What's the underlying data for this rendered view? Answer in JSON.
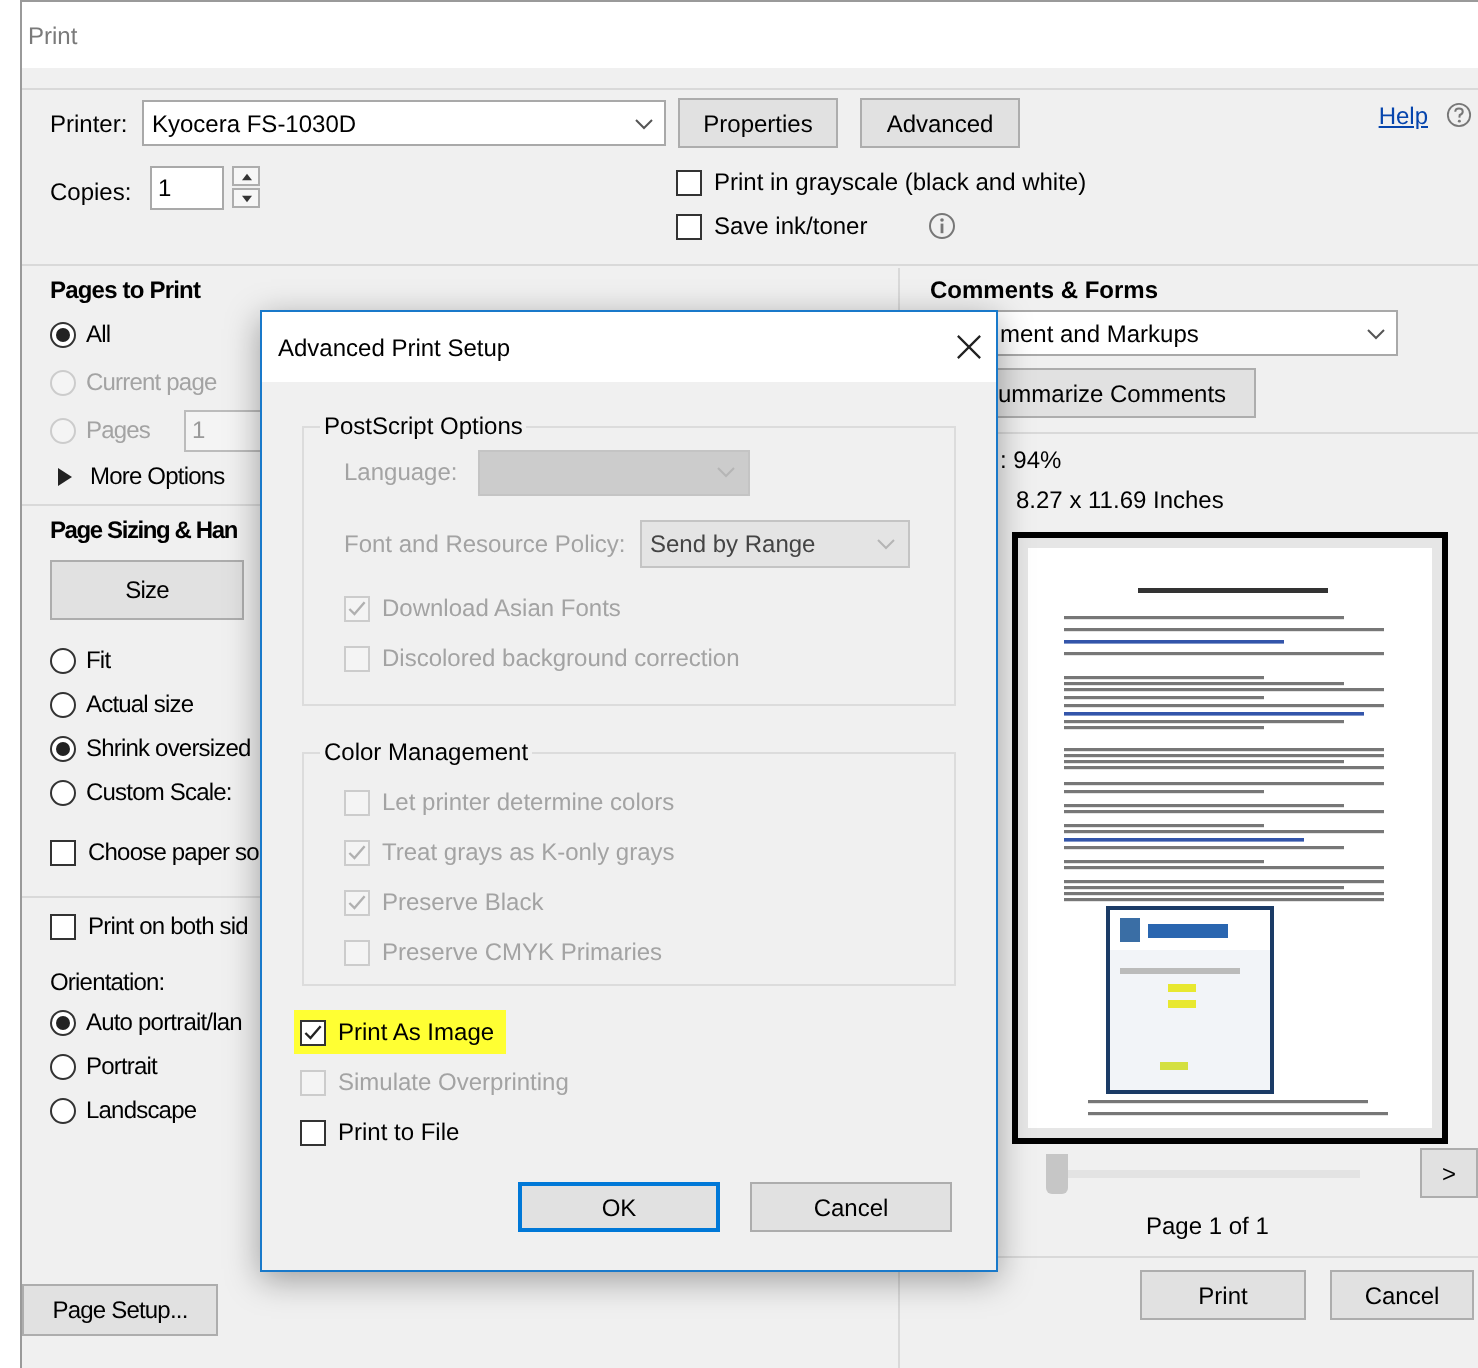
{
  "window": {
    "title": "Print"
  },
  "printer": {
    "label": "Printer:",
    "value": "Kyocera FS-1030D"
  },
  "top_buttons": [
    {
      "label": "Properties"
    },
    {
      "label": "Advanced"
    }
  ],
  "help": {
    "label": "Help"
  },
  "copies": {
    "label": "Copies:",
    "value": "1"
  },
  "print_options": [
    {
      "label": "Print in grayscale (black and white)",
      "checked": false,
      "info": false
    },
    {
      "label": "Save ink/toner",
      "checked": false,
      "info": true
    }
  ],
  "pages_to_print": {
    "title": "Pages to Print",
    "options": [
      {
        "label": "All",
        "selected": true,
        "disabled": false
      },
      {
        "label": "Current page",
        "selected": false,
        "disabled": true
      },
      {
        "label": "Pages",
        "selected": false,
        "disabled": true,
        "value": "1"
      }
    ],
    "more_options": "More Options"
  },
  "page_sizing": {
    "title": "Page Sizing & Han",
    "size_button": "Size",
    "options": [
      {
        "label": "Fit",
        "selected": false
      },
      {
        "label": "Actual size",
        "selected": false
      },
      {
        "label": "Shrink oversized",
        "selected": true
      },
      {
        "label": "Custom Scale:",
        "selected": false
      }
    ],
    "choose_paper": {
      "label": "Choose paper so",
      "checked": false
    }
  },
  "duplex": {
    "label": "Print on both sid",
    "checked": false
  },
  "orientation": {
    "label": "Orientation:",
    "options": [
      {
        "label": "Auto portrait/lan",
        "selected": true
      },
      {
        "label": "Portrait",
        "selected": false
      },
      {
        "label": "Landscape",
        "selected": false
      }
    ]
  },
  "comments_forms": {
    "title": "Comments & Forms",
    "value": "ment and Markups",
    "summarize": "ummarize Comments"
  },
  "preview": {
    "scale": ": 94%",
    "size": "8.27 x 11.69 Inches",
    "slider": {
      "level": 0
    },
    "next": ">",
    "page": "Page 1 of 1"
  },
  "page_setup": "Page Setup...",
  "actions": [
    {
      "label": "Print"
    },
    {
      "label": "Cancel"
    }
  ],
  "advanced_dialog": {
    "title": "Advanced Print Setup",
    "postscript": {
      "title": "PostScript Options",
      "language": {
        "label": "Language:",
        "disabled": true
      },
      "font_policy": {
        "label": "Font and Resource Policy:",
        "value": "Send by Range",
        "disabled": true
      },
      "checks": [
        {
          "label": "Download Asian Fonts",
          "checked": true,
          "disabled": true
        },
        {
          "label": "Discolored background correction",
          "checked": false,
          "disabled": true
        }
      ]
    },
    "color_management": {
      "title": "Color Management",
      "checks": [
        {
          "label": "Let printer determine colors",
          "checked": false,
          "disabled": true
        },
        {
          "label": "Treat grays as K-only grays",
          "checked": true,
          "disabled": true
        },
        {
          "label": "Preserve Black",
          "checked": true,
          "disabled": true
        },
        {
          "label": "Preserve CMYK Primaries",
          "checked": false,
          "disabled": true
        }
      ]
    },
    "options": [
      {
        "label": "Print As Image",
        "checked": true,
        "disabled": false,
        "highlighted": true
      },
      {
        "label": "Simulate Overprinting",
        "checked": false,
        "disabled": true,
        "highlighted": false
      },
      {
        "label": "Print to File",
        "checked": false,
        "disabled": false,
        "highlighted": false
      }
    ],
    "buttons": [
      {
        "label": "OK",
        "default": true
      },
      {
        "label": "Cancel",
        "default": false
      }
    ]
  }
}
